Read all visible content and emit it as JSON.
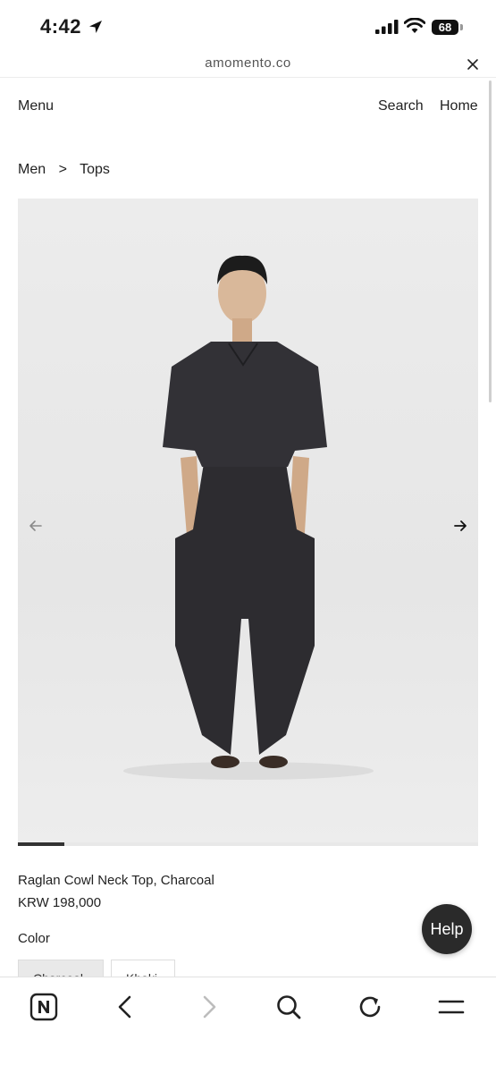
{
  "status_bar": {
    "time": "4:42",
    "battery": "68"
  },
  "browser": {
    "url": "amomento.co"
  },
  "site_nav": {
    "menu": "Menu",
    "search": "Search",
    "home": "Home"
  },
  "breadcrumb": {
    "level1": "Men",
    "separator": ">",
    "level2": "Tops"
  },
  "gallery": {
    "progress": 0.1
  },
  "product": {
    "name": "Raglan Cowl Neck Top, Charcoal",
    "price": "KRW 198,000",
    "color_label": "Color",
    "colors": [
      "Charcoal",
      "Khaki"
    ]
  },
  "help": {
    "label": "Help"
  },
  "icons": {
    "location": "location-arrow-icon",
    "signal": "signal-icon",
    "wifi": "wifi-icon",
    "close": "close-icon",
    "prev": "arrow-left-icon",
    "next": "arrow-right-icon",
    "toolbar": [
      "naver-n-icon",
      "back-icon",
      "forward-icon",
      "search-icon",
      "reload-icon",
      "menu-icon"
    ]
  }
}
